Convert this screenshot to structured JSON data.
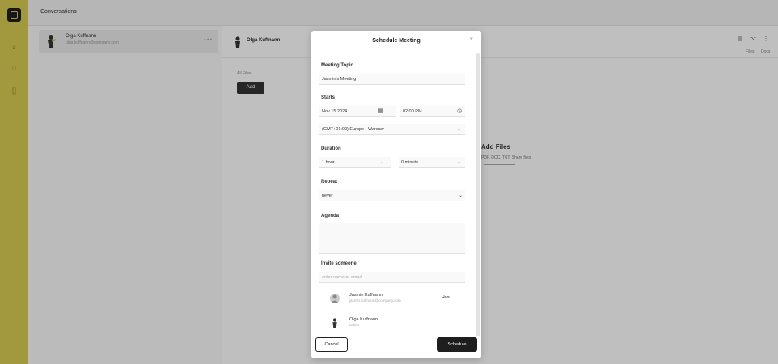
{
  "window": {
    "title": "Conversations"
  },
  "rail": {
    "icons": [
      "app-logo",
      "search-icon",
      "chat-icon",
      "document-icon"
    ]
  },
  "conversation_list": {
    "item": {
      "name": "Olga Kuffnann",
      "subtitle": "olga.kuffnann@company.com",
      "more": "• • •"
    }
  },
  "chat": {
    "header_name": "Olga Kuffnann",
    "buttons": [
      "▤",
      "⌥",
      "⋮"
    ],
    "button_labels": [
      "Files",
      "Docs"
    ],
    "section_label": "All Files",
    "add_label": "Add",
    "files_title": "Add Files",
    "files_sub": "PDF, DOC, TXT, Share files"
  },
  "modal": {
    "title": "Schedule Meeting",
    "close": "×",
    "topic": {
      "label": "Meeting Topic",
      "value": "Jasmin's Meeting"
    },
    "starts": {
      "label": "Starts",
      "date": "Nov 15 2024",
      "time": "02:00 PM",
      "timezone": "(GMT+01:00) Europe - Warsaw"
    },
    "duration": {
      "label": "Duration",
      "hours": "1 hour",
      "minutes": "0 minute"
    },
    "repeat": {
      "label": "Repeat",
      "value": "never"
    },
    "agenda": {
      "label": "Agenda"
    },
    "invite": {
      "label": "Invite someone",
      "placeholder": "enter name or email"
    },
    "invitees": [
      {
        "name": "Jasmin Kuffnann",
        "subtitle": "jasmin.kuffnann@company.com",
        "action": "Host"
      },
      {
        "name": "Olga Kuffnann",
        "subtitle": "Guest"
      }
    ],
    "cancel_label": "Cancel",
    "schedule_label": "Schedule"
  }
}
